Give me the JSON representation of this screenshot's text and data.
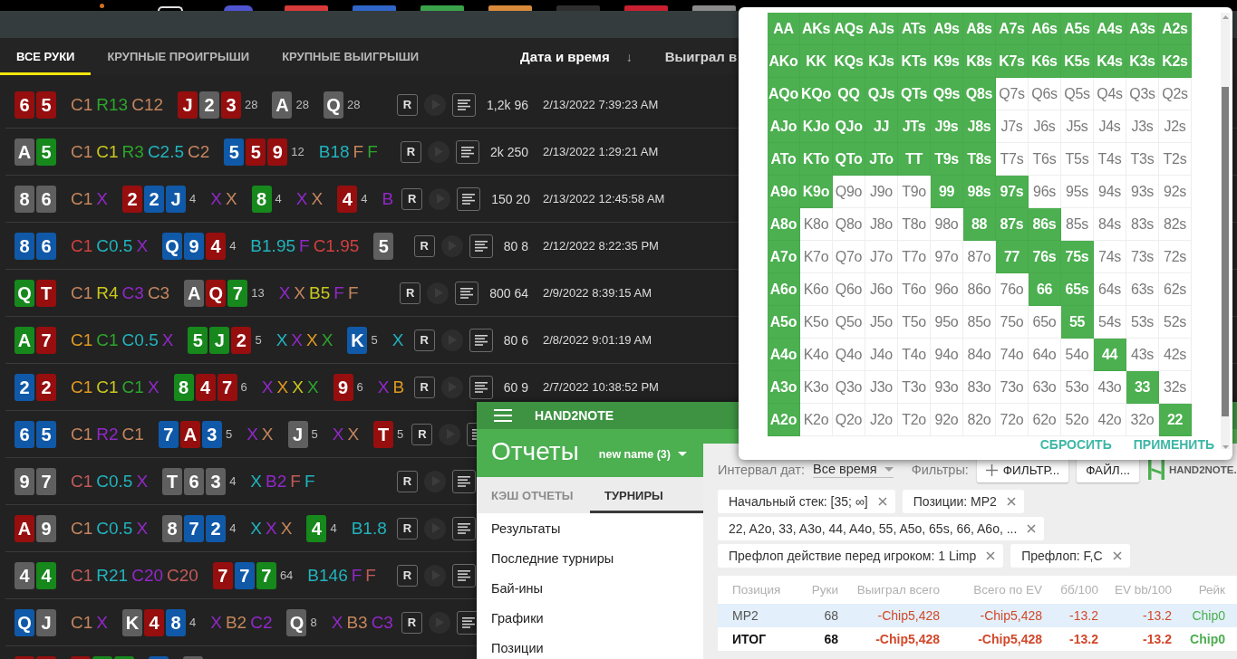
{
  "dock": [
    {
      "kind": "dot",
      "color": "#d07020"
    },
    {
      "kind": "ring",
      "color": "#e0e0e0"
    },
    {
      "kind": "round",
      "color": "#4f55d0"
    },
    {
      "kind": "tile",
      "color": "#d83a3a"
    },
    {
      "kind": "tile",
      "color": "#2f66c8"
    },
    {
      "kind": "tile",
      "color": "#3aa34a"
    },
    {
      "kind": "tile",
      "color": "#d88a3a"
    },
    {
      "kind": "tile",
      "color": "#2e2e2e"
    },
    {
      "kind": "tile",
      "color": "#c82030"
    },
    {
      "kind": "tile",
      "color": "#8a8a8a"
    }
  ],
  "hand_list": {
    "tabs": [
      {
        "label": "ВСЕ РУКИ",
        "selected": true
      },
      {
        "label": "КРУПНЫЕ ПРОИГРЫШИ",
        "selected": false
      },
      {
        "label": "КРУПНЫЕ ВЫИГРЫШИ",
        "selected": false
      }
    ],
    "columns": [
      {
        "label": "Дата и время",
        "sort_mark": "↓"
      },
      {
        "label": "Выиграл в"
      }
    ],
    "rows": [
      {
        "hole": [
          {
            "rank": "6",
            "color": "#960e0e"
          },
          {
            "rank": "5",
            "color": "#960e0e"
          }
        ],
        "preflop": [
          {
            "text": "C1",
            "color": "#c4855d"
          },
          {
            "text": "R13",
            "color": "#2ca52c"
          },
          {
            "text": "C12",
            "color": "#c4855d"
          }
        ],
        "streets": [
          {
            "cards": [
              {
                "rank": "J",
                "color": "#960e0e"
              },
              {
                "rank": "2",
                "color": "#5f5f5f"
              },
              {
                "rank": "3",
                "color": "#960e0e"
              }
            ],
            "pot": "28"
          },
          {
            "cards": [
              {
                "rank": "A",
                "color": "#5f5f5f"
              }
            ],
            "pot": "28"
          },
          {
            "cards": [
              {
                "rank": "Q",
                "color": "#5f5f5f"
              }
            ],
            "pot": "28"
          }
        ],
        "controls": [
          {
            "kind": "replay",
            "label": "R"
          },
          {
            "kind": "play"
          },
          {
            "kind": "notes"
          }
        ],
        "amount": "1,2k 96",
        "date": "2/13/2022 7:39:23 AM"
      },
      {
        "hole": [
          {
            "rank": "A",
            "color": "#5f5f5f"
          },
          {
            "rank": "5",
            "color": "#16881c"
          }
        ],
        "preflop": [
          {
            "text": "C1",
            "color": "#c4855d"
          },
          {
            "text": "C1",
            "color": "#c9c71f"
          },
          {
            "text": "R3",
            "color": "#2ca52c"
          },
          {
            "text": "C2.5",
            "color": "#21b3bd"
          },
          {
            "text": "C2",
            "color": "#c4855d"
          }
        ],
        "streets": [
          {
            "cards": [
              {
                "rank": "5",
                "color": "#1059a8"
              },
              {
                "rank": "5",
                "color": "#960e0e"
              },
              {
                "rank": "9",
                "color": "#960e0e"
              }
            ],
            "pot": "12",
            "actions": [
              {
                "text": "B18",
                "color": "#21b3bd"
              },
              {
                "text": "F",
                "color": "#c4855d"
              },
              {
                "text": "F",
                "color": "#2ca52c"
              }
            ]
          }
        ],
        "controls": [
          {
            "kind": "replay",
            "label": "R"
          },
          {
            "kind": "play"
          },
          {
            "kind": "notes"
          }
        ],
        "amount": "2k 250",
        "date": "2/13/2022 1:29:21 AM"
      },
      {
        "hole": [
          {
            "rank": "8",
            "color": "#5f5f5f"
          },
          {
            "rank": "6",
            "color": "#5f5f5f"
          }
        ],
        "preflop": [
          {
            "text": "C1",
            "color": "#c4855d"
          },
          {
            "text": "X",
            "color": "#9128c8"
          }
        ],
        "streets": [
          {
            "cards": [
              {
                "rank": "2",
                "color": "#960e0e"
              },
              {
                "rank": "2",
                "color": "#1059a8"
              },
              {
                "rank": "J",
                "color": "#1059a8"
              }
            ],
            "pot": "4",
            "actions": [
              {
                "text": "X",
                "color": "#9128c8"
              },
              {
                "text": "X",
                "color": "#c4855d"
              }
            ]
          },
          {
            "cards": [
              {
                "rank": "8",
                "color": "#16881c"
              }
            ],
            "pot": "4",
            "actions": [
              {
                "text": "X",
                "color": "#9128c8"
              },
              {
                "text": "X",
                "color": "#c4855d"
              }
            ]
          },
          {
            "cards": [
              {
                "rank": "4",
                "color": "#960e0e"
              }
            ],
            "pot": "4",
            "actions": [
              {
                "text": "B",
                "color": "#9128c8"
              }
            ]
          }
        ],
        "controls": [
          {
            "kind": "replay",
            "label": "R"
          },
          {
            "kind": "play"
          },
          {
            "kind": "notes"
          }
        ],
        "amount": "150 20",
        "date": "2/13/2022 12:45:58 AM"
      },
      {
        "hole": [
          {
            "rank": "8",
            "color": "#1059a8"
          },
          {
            "rank": "6",
            "color": "#1059a8"
          }
        ],
        "preflop": [
          {
            "text": "C1",
            "color": "#d23f3f"
          },
          {
            "text": "C0.5",
            "color": "#21b3bd"
          },
          {
            "text": "X",
            "color": "#9128c8"
          }
        ],
        "streets": [
          {
            "cards": [
              {
                "rank": "Q",
                "color": "#1059a8"
              },
              {
                "rank": "9",
                "color": "#1059a8"
              },
              {
                "rank": "4",
                "color": "#960e0e"
              }
            ],
            "pot": "4",
            "actions": [
              {
                "text": "B1.95",
                "color": "#21b3bd"
              },
              {
                "text": "F",
                "color": "#9128c8"
              },
              {
                "text": "C1.95",
                "color": "#d23f3f"
              }
            ]
          },
          {
            "cards": [
              {
                "rank": "5",
                "color": "#5f5f5f"
              }
            ]
          }
        ],
        "controls": [
          {
            "kind": "replay",
            "label": "R"
          },
          {
            "kind": "play"
          },
          {
            "kind": "notes"
          }
        ],
        "amount": "80 8",
        "date": "2/12/2022 8:22:35 PM"
      },
      {
        "hole": [
          {
            "rank": "Q",
            "color": "#16881c"
          },
          {
            "rank": "T",
            "color": "#960e0e"
          }
        ],
        "preflop": [
          {
            "text": "C1",
            "color": "#c4855d"
          },
          {
            "text": "R4",
            "color": "#c9c71f"
          },
          {
            "text": "C3",
            "color": "#9128c8"
          },
          {
            "text": "C3",
            "color": "#c4855d"
          }
        ],
        "streets": [
          {
            "cards": [
              {
                "rank": "A",
                "color": "#5f5f5f"
              },
              {
                "rank": "Q",
                "color": "#960e0e"
              },
              {
                "rank": "7",
                "color": "#16881c"
              }
            ],
            "pot": "13",
            "actions": [
              {
                "text": "X",
                "color": "#9128c8"
              },
              {
                "text": "X",
                "color": "#c4855d"
              },
              {
                "text": "B5",
                "color": "#c9c71f"
              },
              {
                "text": "F",
                "color": "#9128c8"
              },
              {
                "text": "F",
                "color": "#c4855d"
              }
            ]
          }
        ],
        "controls": [
          {
            "kind": "replay",
            "label": "R"
          },
          {
            "kind": "play"
          },
          {
            "kind": "notes"
          }
        ],
        "amount": "800 64",
        "date": "2/9/2022 8:39:15 AM"
      },
      {
        "hole": [
          {
            "rank": "A",
            "color": "#16881c"
          },
          {
            "rank": "7",
            "color": "#960e0e"
          }
        ],
        "preflop": [
          {
            "text": "C1",
            "color": "#e09a1e"
          },
          {
            "text": "C1",
            "color": "#2ca52c"
          },
          {
            "text": "C0.5",
            "color": "#21b3bd"
          },
          {
            "text": "X",
            "color": "#9128c8"
          }
        ],
        "streets": [
          {
            "cards": [
              {
                "rank": "5",
                "color": "#16881c"
              },
              {
                "rank": "J",
                "color": "#16881c"
              },
              {
                "rank": "2",
                "color": "#960e0e"
              }
            ],
            "pot": "5",
            "actions": [
              {
                "text": "X",
                "color": "#21b3bd"
              },
              {
                "text": "X",
                "color": "#9128c8"
              },
              {
                "text": "X",
                "color": "#e09a1e"
              },
              {
                "text": "X",
                "color": "#2ca52c"
              }
            ]
          },
          {
            "cards": [
              {
                "rank": "K",
                "color": "#1059a8"
              }
            ],
            "pot": "5",
            "actions": [
              {
                "text": "X",
                "color": "#21b3bd"
              }
            ]
          }
        ],
        "controls": [
          {
            "kind": "replay",
            "label": "R"
          },
          {
            "kind": "play"
          },
          {
            "kind": "notes"
          }
        ],
        "amount": "80 6",
        "date": "2/8/2022 9:01:19 AM"
      },
      {
        "hole": [
          {
            "rank": "2",
            "color": "#1059a8"
          },
          {
            "rank": "2",
            "color": "#960e0e"
          }
        ],
        "preflop": [
          {
            "text": "C1",
            "color": "#e09a1e"
          },
          {
            "text": "C1",
            "color": "#c9c71f"
          },
          {
            "text": "C1",
            "color": "#2ca52c"
          },
          {
            "text": "X",
            "color": "#9128c8"
          }
        ],
        "streets": [
          {
            "cards": [
              {
                "rank": "8",
                "color": "#16881c"
              },
              {
                "rank": "4",
                "color": "#960e0e"
              },
              {
                "rank": "7",
                "color": "#960e0e"
              }
            ],
            "pot": "6",
            "actions": [
              {
                "text": "X",
                "color": "#9128c8"
              },
              {
                "text": "X",
                "color": "#e09a1e"
              },
              {
                "text": "X",
                "color": "#c9c71f"
              },
              {
                "text": "X",
                "color": "#2ca52c"
              }
            ]
          },
          {
            "cards": [
              {
                "rank": "9",
                "color": "#960e0e"
              }
            ],
            "pot": "6",
            "actions": [
              {
                "text": "X",
                "color": "#9128c8"
              },
              {
                "text": "B",
                "color": "#e09a1e"
              }
            ]
          }
        ],
        "controls": [
          {
            "kind": "replay",
            "label": "R"
          },
          {
            "kind": "play"
          },
          {
            "kind": "notes"
          }
        ],
        "amount": "60 9",
        "date": "2/7/2022 10:38:52 PM"
      },
      {
        "hole": [
          {
            "rank": "6",
            "color": "#1059a8"
          },
          {
            "rank": "5",
            "color": "#1059a8"
          }
        ],
        "preflop": [
          {
            "text": "C1",
            "color": "#c4855d"
          },
          {
            "text": "R2",
            "color": "#9128c8"
          },
          {
            "text": "C1",
            "color": "#c4855d"
          }
        ],
        "streets": [
          {
            "cards": [
              {
                "rank": "7",
                "color": "#1059a8"
              },
              {
                "rank": "A",
                "color": "#960e0e"
              },
              {
                "rank": "3",
                "color": "#1059a8"
              }
            ],
            "pot": "5",
            "actions": [
              {
                "text": "X",
                "color": "#9128c8"
              },
              {
                "text": "X",
                "color": "#c4855d"
              }
            ]
          },
          {
            "cards": [
              {
                "rank": "J",
                "color": "#5f5f5f"
              }
            ],
            "pot": "5",
            "actions": [
              {
                "text": "X",
                "color": "#9128c8"
              },
              {
                "text": "X",
                "color": "#c4855d"
              }
            ]
          },
          {
            "cards": [
              {
                "rank": "T",
                "color": "#960e0e"
              }
            ],
            "pot": "5"
          }
        ],
        "controls": [
          {
            "kind": "replay",
            "label": "R"
          },
          {
            "kind": "play"
          },
          {
            "kind": "notes"
          }
        ]
      },
      {
        "hole": [
          {
            "rank": "9",
            "color": "#5f5f5f"
          },
          {
            "rank": "7",
            "color": "#5f5f5f"
          }
        ],
        "preflop": [
          {
            "text": "C1",
            "color": "#c45a5a"
          },
          {
            "text": "C0.5",
            "color": "#21b3bd"
          },
          {
            "text": "X",
            "color": "#9128c8"
          }
        ],
        "streets": [
          {
            "cards": [
              {
                "rank": "T",
                "color": "#5f5f5f"
              },
              {
                "rank": "6",
                "color": "#5f5f5f"
              },
              {
                "rank": "3",
                "color": "#5f5f5f"
              }
            ],
            "pot": "4",
            "actions": [
              {
                "text": "X",
                "color": "#21b3bd"
              },
              {
                "text": "B2",
                "color": "#9128c8"
              },
              {
                "text": "F",
                "color": "#c45a5a"
              },
              {
                "text": "F",
                "color": "#21b3bd"
              }
            ]
          }
        ],
        "controls": [
          {
            "kind": "replay",
            "label": "R"
          },
          {
            "kind": "play"
          },
          {
            "kind": "notes"
          }
        ]
      },
      {
        "hole": [
          {
            "rank": "A",
            "color": "#960e0e"
          },
          {
            "rank": "9",
            "color": "#5f5f5f"
          }
        ],
        "preflop": [
          {
            "text": "C1",
            "color": "#c4855d"
          },
          {
            "text": "C0.5",
            "color": "#21b3bd"
          },
          {
            "text": "X",
            "color": "#9128c8"
          }
        ],
        "streets": [
          {
            "cards": [
              {
                "rank": "8",
                "color": "#5f5f5f"
              },
              {
                "rank": "7",
                "color": "#1059a8"
              },
              {
                "rank": "2",
                "color": "#1059a8"
              }
            ],
            "pot": "4",
            "actions": [
              {
                "text": "X",
                "color": "#21b3bd"
              },
              {
                "text": "X",
                "color": "#9128c8"
              },
              {
                "text": "X",
                "color": "#c4855d"
              }
            ]
          },
          {
            "cards": [
              {
                "rank": "4",
                "color": "#16881c"
              }
            ],
            "pot": "4",
            "actions": [
              {
                "text": "B1.8",
                "color": "#21b3bd"
              }
            ]
          }
        ],
        "controls": [
          {
            "kind": "replay",
            "label": "R"
          },
          {
            "kind": "play"
          },
          {
            "kind": "notes"
          }
        ]
      },
      {
        "hole": [
          {
            "rank": "4",
            "color": "#5f5f5f"
          },
          {
            "rank": "4",
            "color": "#16881c"
          }
        ],
        "preflop": [
          {
            "text": "C1",
            "color": "#c45a5a"
          },
          {
            "text": "R21",
            "color": "#21b3bd"
          },
          {
            "text": "C20",
            "color": "#9128c8"
          },
          {
            "text": "C20",
            "color": "#c45a5a"
          }
        ],
        "streets": [
          {
            "cards": [
              {
                "rank": "7",
                "color": "#960e0e"
              },
              {
                "rank": "7",
                "color": "#1059a8"
              },
              {
                "rank": "7",
                "color": "#16881c"
              }
            ],
            "pot": "64",
            "actions": [
              {
                "text": "B146",
                "color": "#21b3bd"
              },
              {
                "text": "F",
                "color": "#9128c8"
              },
              {
                "text": "F",
                "color": "#c45a5a"
              }
            ]
          }
        ],
        "controls": [
          {
            "kind": "replay",
            "label": "R"
          },
          {
            "kind": "play"
          },
          {
            "kind": "notes"
          }
        ]
      },
      {
        "hole": [
          {
            "rank": "Q",
            "color": "#1059a8"
          },
          {
            "rank": "J",
            "color": "#5f5f5f"
          }
        ],
        "preflop": [
          {
            "text": "C1",
            "color": "#c4855d"
          },
          {
            "text": "X",
            "color": "#9128c8"
          }
        ],
        "streets": [
          {
            "cards": [
              {
                "rank": "K",
                "color": "#5f5f5f"
              },
              {
                "rank": "4",
                "color": "#960e0e"
              },
              {
                "rank": "8",
                "color": "#1059a8"
              }
            ],
            "pot": "4",
            "actions": [
              {
                "text": "X",
                "color": "#9128c8"
              },
              {
                "text": "B2",
                "color": "#c4855d"
              },
              {
                "text": "C2",
                "color": "#9128c8"
              }
            ]
          },
          {
            "cards": [
              {
                "rank": "Q",
                "color": "#5f5f5f"
              }
            ],
            "pot": "8",
            "actions": [
              {
                "text": "X",
                "color": "#9128c8"
              },
              {
                "text": "B3",
                "color": "#c4855d"
              },
              {
                "text": "C3",
                "color": "#9128c8"
              }
            ]
          }
        ],
        "controls": [
          {
            "kind": "replay",
            "label": "R"
          },
          {
            "kind": "play"
          },
          {
            "kind": "notes"
          }
        ]
      },
      {
        "hole": [
          {
            "color": "#960e0e"
          },
          {
            "color": "#960e0e"
          }
        ],
        "streets": [
          {
            "cards": [
              {
                "color": "#960e0e"
              },
              {
                "color": "#16881c"
              },
              {
                "color": "#16881c"
              }
            ]
          },
          {
            "cards": [
              {
                "color": "#1059a8"
              }
            ]
          },
          {
            "cards": [
              {
                "color": "#5f5f5f"
              }
            ]
          }
        ]
      }
    ]
  },
  "range_popup": {
    "grid": [
      [
        {
          "label": "AA",
          "selected": true
        },
        {
          "label": "AKs",
          "selected": true
        },
        {
          "label": "AQs",
          "selected": true
        },
        {
          "label": "AJs",
          "selected": true
        },
        {
          "label": "ATs",
          "selected": true
        },
        {
          "label": "A9s",
          "selected": true
        },
        {
          "label": "A8s",
          "selected": true
        },
        {
          "label": "A7s",
          "selected": true
        },
        {
          "label": "A6s",
          "selected": true
        },
        {
          "label": "A5s",
          "selected": true
        },
        {
          "label": "A4s",
          "selected": true
        },
        {
          "label": "A3s",
          "selected": true
        },
        {
          "label": "A2s",
          "selected": true
        }
      ],
      [
        {
          "label": "AKo",
          "selected": true
        },
        {
          "label": "KK",
          "selected": true
        },
        {
          "label": "KQs",
          "selected": true
        },
        {
          "label": "KJs",
          "selected": true
        },
        {
          "label": "KTs",
          "selected": true
        },
        {
          "label": "K9s",
          "selected": true
        },
        {
          "label": "K8s",
          "selected": true
        },
        {
          "label": "K7s",
          "selected": true
        },
        {
          "label": "K6s",
          "selected": true
        },
        {
          "label": "K5s",
          "selected": true
        },
        {
          "label": "K4s",
          "selected": true
        },
        {
          "label": "K3s",
          "selected": true
        },
        {
          "label": "K2s",
          "selected": true
        }
      ],
      [
        {
          "label": "AQo",
          "selected": true
        },
        {
          "label": "KQo",
          "selected": true
        },
        {
          "label": "QQ",
          "selected": true
        },
        {
          "label": "QJs",
          "selected": true
        },
        {
          "label": "QTs",
          "selected": true
        },
        {
          "label": "Q9s",
          "selected": true
        },
        {
          "label": "Q8s",
          "selected": true
        },
        {
          "label": "Q7s",
          "selected": false
        },
        {
          "label": "Q6s",
          "selected": false
        },
        {
          "label": "Q5s",
          "selected": false
        },
        {
          "label": "Q4s",
          "selected": false
        },
        {
          "label": "Q3s",
          "selected": false
        },
        {
          "label": "Q2s",
          "selected": false
        }
      ],
      [
        {
          "label": "AJo",
          "selected": true
        },
        {
          "label": "KJo",
          "selected": true
        },
        {
          "label": "QJo",
          "selected": true
        },
        {
          "label": "JJ",
          "selected": true
        },
        {
          "label": "JTs",
          "selected": true
        },
        {
          "label": "J9s",
          "selected": true
        },
        {
          "label": "J8s",
          "selected": true
        },
        {
          "label": "J7s",
          "selected": false
        },
        {
          "label": "J6s",
          "selected": false
        },
        {
          "label": "J5s",
          "selected": false
        },
        {
          "label": "J4s",
          "selected": false
        },
        {
          "label": "J3s",
          "selected": false
        },
        {
          "label": "J2s",
          "selected": false
        }
      ],
      [
        {
          "label": "ATo",
          "selected": true
        },
        {
          "label": "KTo",
          "selected": true
        },
        {
          "label": "QTo",
          "selected": true
        },
        {
          "label": "JTo",
          "selected": true
        },
        {
          "label": "TT",
          "selected": true
        },
        {
          "label": "T9s",
          "selected": true
        },
        {
          "label": "T8s",
          "selected": true
        },
        {
          "label": "T7s",
          "selected": false
        },
        {
          "label": "T6s",
          "selected": false
        },
        {
          "label": "T5s",
          "selected": false
        },
        {
          "label": "T4s",
          "selected": false
        },
        {
          "label": "T3s",
          "selected": false
        },
        {
          "label": "T2s",
          "selected": false
        }
      ],
      [
        {
          "label": "A9o",
          "selected": true
        },
        {
          "label": "K9o",
          "selected": true
        },
        {
          "label": "Q9o",
          "selected": false
        },
        {
          "label": "J9o",
          "selected": false
        },
        {
          "label": "T9o",
          "selected": false
        },
        {
          "label": "99",
          "selected": true
        },
        {
          "label": "98s",
          "selected": true
        },
        {
          "label": "97s",
          "selected": true
        },
        {
          "label": "96s",
          "selected": false
        },
        {
          "label": "95s",
          "selected": false
        },
        {
          "label": "94s",
          "selected": false
        },
        {
          "label": "93s",
          "selected": false
        },
        {
          "label": "92s",
          "selected": false
        }
      ],
      [
        {
          "label": "A8o",
          "selected": true
        },
        {
          "label": "K8o",
          "selected": false
        },
        {
          "label": "Q8o",
          "selected": false
        },
        {
          "label": "J8o",
          "selected": false
        },
        {
          "label": "T8o",
          "selected": false
        },
        {
          "label": "98o",
          "selected": false
        },
        {
          "label": "88",
          "selected": true
        },
        {
          "label": "87s",
          "selected": true
        },
        {
          "label": "86s",
          "selected": true
        },
        {
          "label": "85s",
          "selected": false
        },
        {
          "label": "84s",
          "selected": false
        },
        {
          "label": "83s",
          "selected": false
        },
        {
          "label": "82s",
          "selected": false
        }
      ],
      [
        {
          "label": "A7o",
          "selected": true
        },
        {
          "label": "K7o",
          "selected": false
        },
        {
          "label": "Q7o",
          "selected": false
        },
        {
          "label": "J7o",
          "selected": false
        },
        {
          "label": "T7o",
          "selected": false
        },
        {
          "label": "97o",
          "selected": false
        },
        {
          "label": "87o",
          "selected": false
        },
        {
          "label": "77",
          "selected": true
        },
        {
          "label": "76s",
          "selected": true
        },
        {
          "label": "75s",
          "selected": true
        },
        {
          "label": "74s",
          "selected": false
        },
        {
          "label": "73s",
          "selected": false
        },
        {
          "label": "72s",
          "selected": false
        }
      ],
      [
        {
          "label": "A6o",
          "selected": true
        },
        {
          "label": "K6o",
          "selected": false
        },
        {
          "label": "Q6o",
          "selected": false
        },
        {
          "label": "J6o",
          "selected": false
        },
        {
          "label": "T6o",
          "selected": false
        },
        {
          "label": "96o",
          "selected": false
        },
        {
          "label": "86o",
          "selected": false
        },
        {
          "label": "76o",
          "selected": false
        },
        {
          "label": "66",
          "selected": true
        },
        {
          "label": "65s",
          "selected": true
        },
        {
          "label": "64s",
          "selected": false
        },
        {
          "label": "63s",
          "selected": false
        },
        {
          "label": "62s",
          "selected": false
        }
      ],
      [
        {
          "label": "A5o",
          "selected": true
        },
        {
          "label": "K5o",
          "selected": false
        },
        {
          "label": "Q5o",
          "selected": false
        },
        {
          "label": "J5o",
          "selected": false
        },
        {
          "label": "T5o",
          "selected": false
        },
        {
          "label": "95o",
          "selected": false
        },
        {
          "label": "85o",
          "selected": false
        },
        {
          "label": "75o",
          "selected": false
        },
        {
          "label": "65o",
          "selected": false
        },
        {
          "label": "55",
          "selected": true
        },
        {
          "label": "54s",
          "selected": false
        },
        {
          "label": "53s",
          "selected": false
        },
        {
          "label": "52s",
          "selected": false
        }
      ],
      [
        {
          "label": "A4o",
          "selected": true
        },
        {
          "label": "K4o",
          "selected": false
        },
        {
          "label": "Q4o",
          "selected": false
        },
        {
          "label": "J4o",
          "selected": false
        },
        {
          "label": "T4o",
          "selected": false
        },
        {
          "label": "94o",
          "selected": false
        },
        {
          "label": "84o",
          "selected": false
        },
        {
          "label": "74o",
          "selected": false
        },
        {
          "label": "64o",
          "selected": false
        },
        {
          "label": "54o",
          "selected": false
        },
        {
          "label": "44",
          "selected": true
        },
        {
          "label": "43s",
          "selected": false
        },
        {
          "label": "42s",
          "selected": false
        }
      ],
      [
        {
          "label": "A3o",
          "selected": true
        },
        {
          "label": "K3o",
          "selected": false
        },
        {
          "label": "Q3o",
          "selected": false
        },
        {
          "label": "J3o",
          "selected": false
        },
        {
          "label": "T3o",
          "selected": false
        },
        {
          "label": "93o",
          "selected": false
        },
        {
          "label": "83o",
          "selected": false
        },
        {
          "label": "73o",
          "selected": false
        },
        {
          "label": "63o",
          "selected": false
        },
        {
          "label": "53o",
          "selected": false
        },
        {
          "label": "43o",
          "selected": false
        },
        {
          "label": "33",
          "selected": true
        },
        {
          "label": "32s",
          "selected": false
        }
      ],
      [
        {
          "label": "A2o",
          "selected": true
        },
        {
          "label": "K2o",
          "selected": false
        },
        {
          "label": "Q2o",
          "selected": false
        },
        {
          "label": "J2o",
          "selected": false
        },
        {
          "label": "T2o",
          "selected": false
        },
        {
          "label": "92o",
          "selected": false
        },
        {
          "label": "82o",
          "selected": false
        },
        {
          "label": "72o",
          "selected": false
        },
        {
          "label": "62o",
          "selected": false
        },
        {
          "label": "52o",
          "selected": false
        },
        {
          "label": "42o",
          "selected": false
        },
        {
          "label": "32o",
          "selected": false
        },
        {
          "label": "22",
          "selected": true
        }
      ]
    ],
    "buttons": [
      "СБРОСИТЬ",
      "ПРИМЕНИТЬ"
    ]
  },
  "hand2note": {
    "title": "HAND2NOTE",
    "page_title": "Отчеты",
    "report_name": "new name (3)",
    "tabs": [
      {
        "label": "КЭШ ОТЧЕТЫ",
        "selected": false
      },
      {
        "label": "ТУРНИРЫ",
        "selected": true
      }
    ],
    "menu": [
      "Результаты",
      "Последние турниры",
      "Бай-ины",
      "Графики",
      "Позиции"
    ],
    "date_range": {
      "label": "Интервал дат:",
      "value": "Все время"
    },
    "filters_label": "Фильтры:",
    "buttons": [
      {
        "kind": "add",
        "label": "ФИЛЬТР..."
      },
      {
        "kind": "plain",
        "label": "ФАЙЛ..."
      }
    ],
    "logo": "HAND2NOTE.",
    "filter_rows": [
      [
        "Начальный стек: [35; ∞]",
        "Позиции: MP2"
      ],
      [
        "22, A2o, 33, A3o, 44, A4o, 55, A5o, 65s, 66, A6o, ..."
      ],
      [
        "Префлоп действие перед игроком: 1 Limp",
        "Префлоп: F,C"
      ]
    ],
    "table": {
      "columns": [
        "Позиция",
        "Руки",
        "Выиграл всего",
        "Всего по EV",
        "бб/100",
        "EV bb/100",
        "Рейк"
      ],
      "rows": [
        {
          "kind": "data",
          "selected": true,
          "cells": [
            {
              "text": "MP2"
            },
            {
              "text": "68"
            },
            {
              "text": "-Chip5,428",
              "color": "#d2482a"
            },
            {
              "text": "-Chip5,428",
              "color": "#d2482a"
            },
            {
              "text": "-13.2",
              "color": "#d2482a"
            },
            {
              "text": "-13.2",
              "color": "#d2482a"
            },
            {
              "text": "Chip0",
              "color": "#4cae4f"
            }
          ]
        },
        {
          "kind": "total",
          "selected": false,
          "cells": [
            {
              "text": "ИТОГ"
            },
            {
              "text": "68"
            },
            {
              "text": "-Chip5,428",
              "color": "#d2482a"
            },
            {
              "text": "-Chip5,428",
              "color": "#d2482a"
            },
            {
              "text": "-13.2",
              "color": "#d2482a"
            },
            {
              "text": "-13.2",
              "color": "#d2482a"
            },
            {
              "text": "Chip0",
              "color": "#4cae4f"
            }
          ]
        }
      ]
    }
  }
}
